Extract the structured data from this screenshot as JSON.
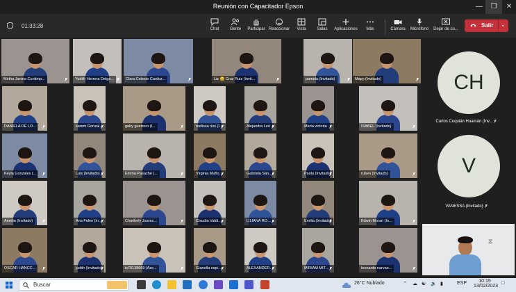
{
  "window": {
    "title": "Reunión con Capacitador Epson"
  },
  "toolbar": {
    "timer": "01:33:28",
    "buttons": [
      "Chat",
      "Gente",
      "Participar",
      "Reaccionar",
      "Vista",
      "Salas",
      "Aplicaciones",
      "Más",
      "Cámara",
      "Micrófono",
      "Dejar de co..."
    ],
    "leave_label": "Salir"
  },
  "participants": [
    "Mirtha Janina Cuntimp...",
    "Yudith Herrera Delga...",
    "Clara Celeste Cardoz...",
    "Liz 😊 Cruz Ruiz (Invit...",
    "pamela (Invitado)",
    "Mapy (Invitado)",
    "DANIELA DE LO...",
    "karem Gonzalez...",
    "gaby guerrero (I...",
    "melissa rios (Invi...",
    "Alejandra León (...",
    "Maria victoria (I...",
    "ISABEL (Invitado)",
    "Keyla Gonzales (...",
    "Luis (Invitado)",
    "Emma Pasaché (...",
    "Virginia Muñoz ...",
    "Gabriela Sánche...",
    "Paola (Invitado)",
    "ruben (Invitado)",
    "Amelia (Invitado)",
    "Ana Falen (Invita...",
    "Charibely Juarez...",
    "Claudia Valdivie...",
    "LILIANA ROMER...",
    "Emilia (Invitado)",
    "Edwin Moran (In...",
    "OSCAR HANCC...",
    "judith (Invitado)",
    "ic70138669 (Asc...",
    "Gianella espinoz...",
    "ALEXANDER (...",
    "MIRIAM MITMA...",
    "leonardo narvae..."
  ],
  "side_participants": [
    {
      "initials": "CH",
      "name": "Carlos Cuquián Huamán (Inv..."
    },
    {
      "initials": "V",
      "name": "VANESSA (Invitado)"
    }
  ],
  "taskbar": {
    "search_placeholder": "Buscar",
    "weather": "26°C  Nublado",
    "language": "ESP",
    "time": "10:15",
    "date": "13/02/2023"
  },
  "colors": {
    "leave": "#c4313b",
    "toolbar": "#292929",
    "stage": "#1f1f1f",
    "avatar": "#dfe3d9"
  }
}
